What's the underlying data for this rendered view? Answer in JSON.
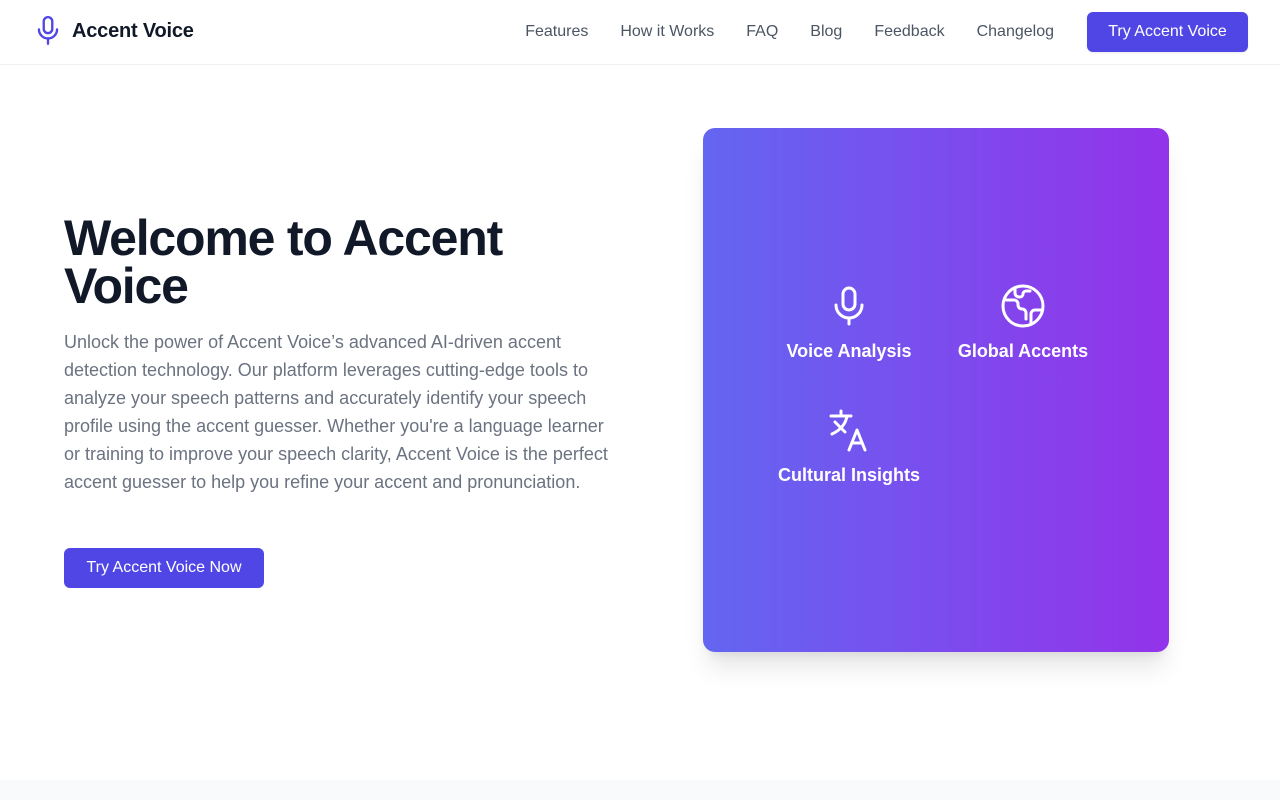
{
  "brand": {
    "name": "Accent Voice",
    "icon": "microphone-icon",
    "accent_color": "#4f46e5"
  },
  "nav": {
    "links": [
      "Features",
      "How it Works",
      "FAQ",
      "Blog",
      "Feedback",
      "Changelog"
    ],
    "cta_label": "Try Accent Voice"
  },
  "hero": {
    "title": "Welcome to Accent Voice",
    "description": "Unlock the power of Accent Voice’s advanced AI-driven accent detection technology. Our platform leverages cutting-edge tools to analyze your speech patterns and accurately identify your speech profile using the accent guesser. Whether you're a language learner or training to improve your speech clarity, Accent Voice is the perfect accent guesser to help you refine your accent and pronunciation.",
    "cta_label": "Try Accent Voice Now"
  },
  "feature_card": {
    "gradient_from": "#6366f1",
    "gradient_to": "#9333ea",
    "items": [
      {
        "label": "Voice Analysis",
        "icon": "microphone-icon"
      },
      {
        "label": "Global Accents",
        "icon": "globe-icon"
      },
      {
        "label": "Cultural Insights",
        "icon": "language-icon"
      }
    ]
  }
}
